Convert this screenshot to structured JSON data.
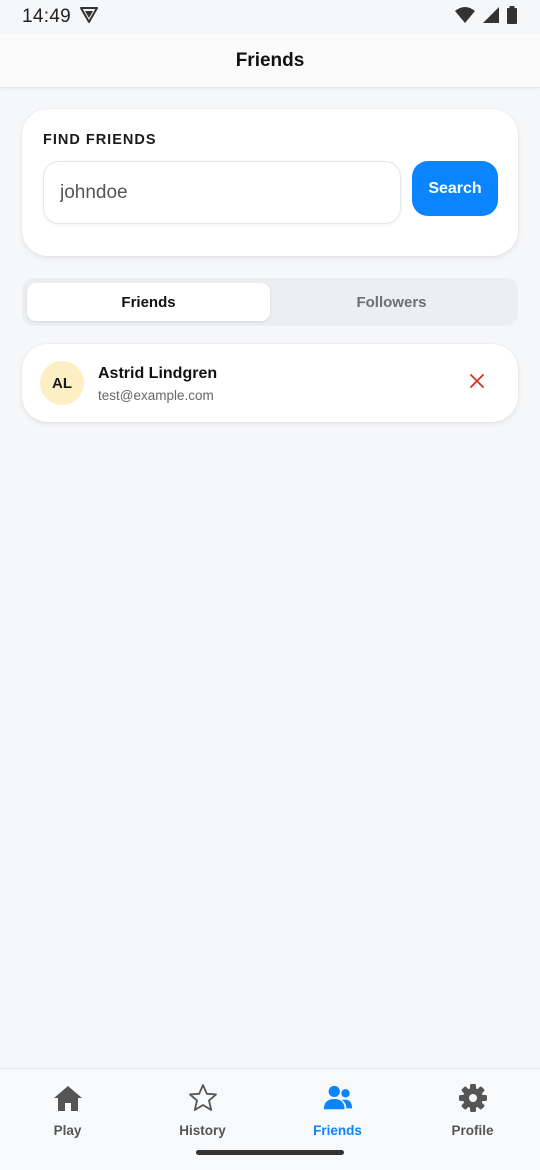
{
  "status_bar": {
    "time": "14:49",
    "icons": [
      "vpn-shield-icon",
      "wifi-icon",
      "signal-icon",
      "battery-icon"
    ]
  },
  "header": {
    "title": "Friends"
  },
  "find_friends": {
    "label": "FIND FRIENDS",
    "input_value": "johndoe",
    "search_label": "Search"
  },
  "tabs": [
    {
      "label": "Friends",
      "active": true
    },
    {
      "label": "Followers",
      "active": false
    }
  ],
  "friends": [
    {
      "initials": "AL",
      "name": "Astrid Lindgren",
      "email": "test@example.com",
      "avatar_color": "#fdefc4",
      "remove_icon": "close-icon"
    }
  ],
  "bottom_nav": [
    {
      "label": "Play",
      "icon": "home-icon",
      "active": false
    },
    {
      "label": "History",
      "icon": "star-icon",
      "active": false
    },
    {
      "label": "Friends",
      "icon": "users-icon",
      "active": true
    },
    {
      "label": "Profile",
      "icon": "gear-icon",
      "active": false
    }
  ],
  "colors": {
    "accent": "#0a84ff",
    "danger": "#d93025",
    "background": "#f6f7f9"
  }
}
